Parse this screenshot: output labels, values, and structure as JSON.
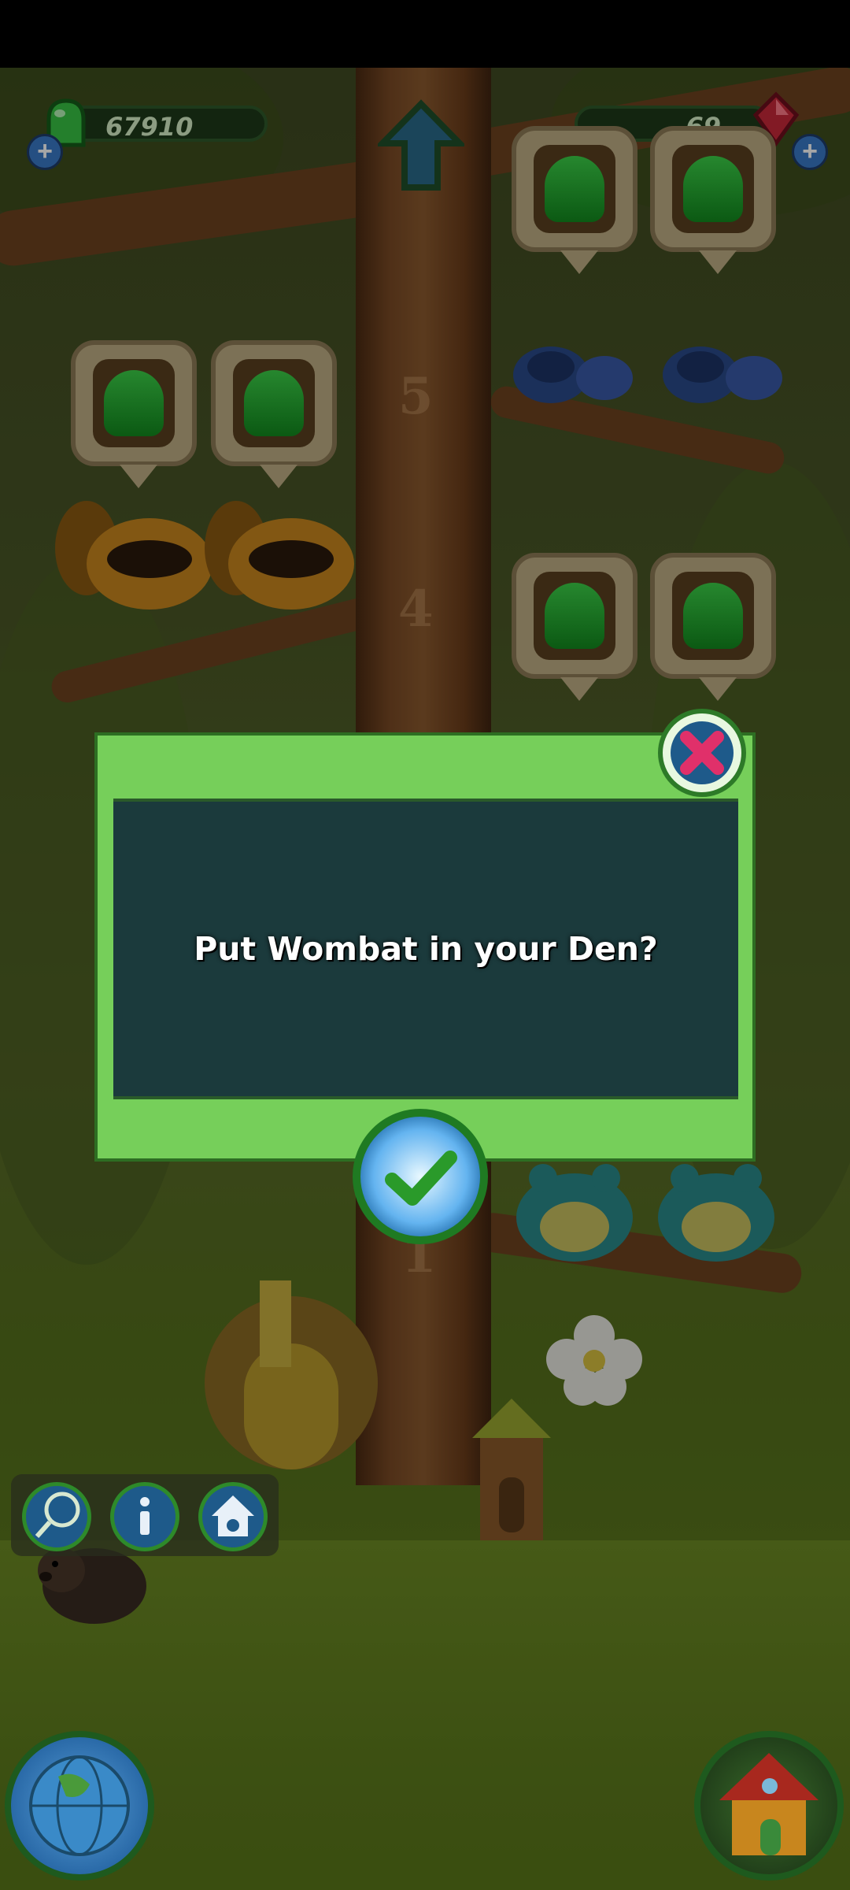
{
  "hud": {
    "coins": "67910",
    "gems": "69",
    "add_coins_label": "+",
    "add_gems_label": "+"
  },
  "tree": {
    "floor_5": "5",
    "floor_4": "4",
    "floor_1": "1"
  },
  "dialog": {
    "message": "Put Wombat in your Den?",
    "close_icon": "close-x-icon",
    "confirm_icon": "checkmark-icon"
  },
  "toolbar": {
    "net_icon": "net-icon",
    "info_icon": "info-icon",
    "den_icon": "den-icon"
  },
  "colors": {
    "dialog_frame": "#76cf5a",
    "dialog_body": "#1b3a3c",
    "jelly": "#2fbf3c"
  }
}
